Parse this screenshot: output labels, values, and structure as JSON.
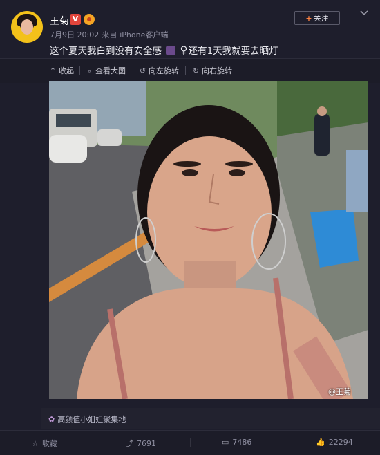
{
  "header": {
    "username": "王菊",
    "verified_badge": "V",
    "timestamp": "7月9日 20:02",
    "source_prefix": "来自",
    "source": "iPhone客户端",
    "follow_label": "关注"
  },
  "post": {
    "text_part1": "这个夏天我白到没有安全感",
    "text_part2": "还有1天我就要去晒灯",
    "watermark": "@王菊"
  },
  "toolbar": {
    "collapse_label": "收起",
    "view_large_label": "查看大图",
    "rotate_left_label": "向左旋转",
    "rotate_right_label": "向右旋转"
  },
  "topic": {
    "label": "高颜值小姐姐聚集地"
  },
  "actions": {
    "favorite_label": "收藏",
    "repost_count": "7691",
    "comment_count": "7486",
    "like_count": "22294"
  },
  "colors": {
    "background": "#1e1e2c",
    "accent_orange": "#ff8140",
    "verified_red": "#e2453c"
  }
}
